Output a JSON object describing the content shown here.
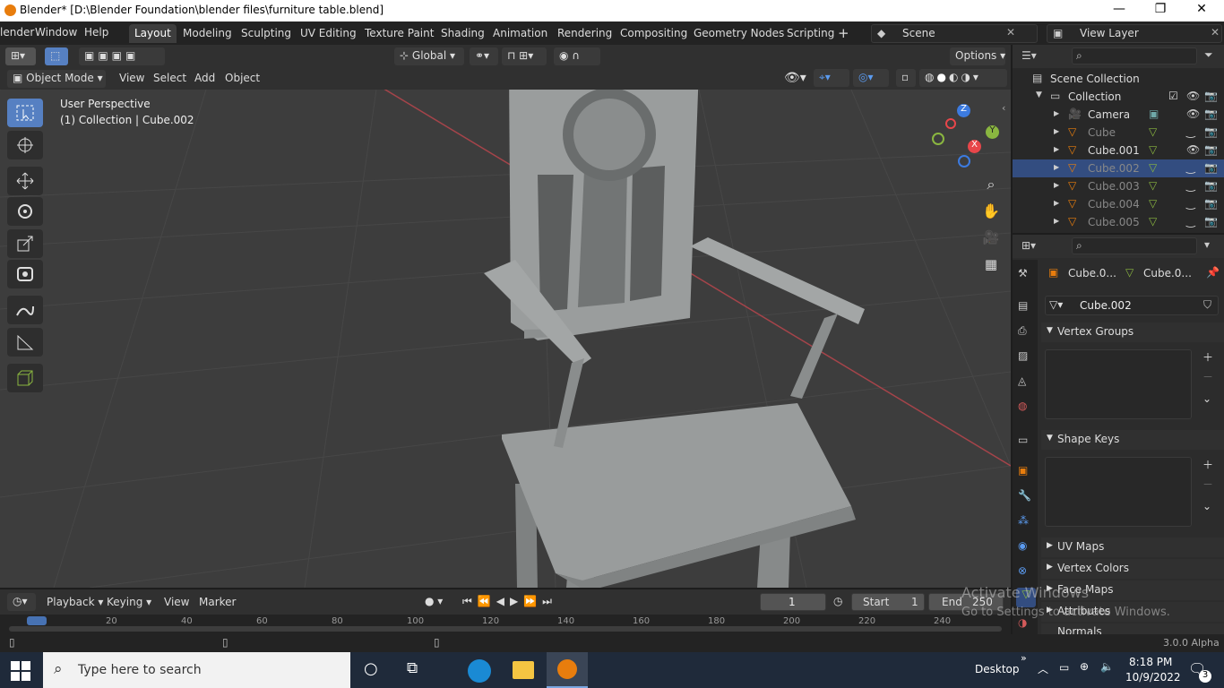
{
  "window": {
    "title": "Blender* [D:\\Blender Foundation\\blender files\\furniture table.blend]",
    "minimize": "—",
    "maximize": "❐",
    "close": "✕"
  },
  "workspaces": [
    "Layout",
    "Modeling",
    "Sculpting",
    "UV Editing",
    "Texture Paint",
    "Shading",
    "Animation",
    "Rendering",
    "Compositing",
    "Geometry Nodes",
    "Scripting"
  ],
  "menus": {
    "blender": "lender",
    "window": "Window",
    "help": "Help"
  },
  "scene": {
    "name": "Scene",
    "view_layer": "View Layer"
  },
  "viewport_header": {
    "transform_orientation": "Global",
    "options": "Options",
    "mode": "Object Mode",
    "menu_view": "View",
    "menu_select": "Select",
    "menu_add": "Add",
    "menu_object": "Object"
  },
  "viewport_info": {
    "perspective": "User Perspective",
    "collection": "(1) Collection | Cube.002"
  },
  "gizmo": {
    "z": "Z",
    "y": "Y",
    "x": "X"
  },
  "outliner": {
    "root": "Scene Collection",
    "collection": "Collection",
    "items": [
      {
        "name": "Camera",
        "dim": false
      },
      {
        "name": "Cube",
        "dim": true
      },
      {
        "name": "Cube.001",
        "dim": false
      },
      {
        "name": "Cube.002",
        "dim": true,
        "selected": true
      },
      {
        "name": "Cube.003",
        "dim": true
      },
      {
        "name": "Cube.004",
        "dim": true
      },
      {
        "name": "Cube.005",
        "dim": true
      }
    ]
  },
  "properties": {
    "breadcrumb_object": "Cube.0...",
    "breadcrumb_mesh": "Cube.0...",
    "mesh_name": "Cube.002",
    "panels": {
      "vertex_groups": "Vertex Groups",
      "shape_keys": "Shape Keys",
      "uv_maps": "UV Maps",
      "vertex_colors": "Vertex Colors",
      "face_maps": "Face Maps",
      "attributes": "Attributes",
      "normals": "Normals"
    }
  },
  "timeline": {
    "playback": "Playback",
    "keying": "Keying",
    "view": "View",
    "marker": "Marker",
    "current_frame": "1",
    "start_label": "Start",
    "start": "1",
    "end_label": "End",
    "end": "250",
    "ticks": [
      "0",
      "20",
      "40",
      "60",
      "80",
      "100",
      "120",
      "140",
      "160",
      "180",
      "200",
      "220",
      "240"
    ]
  },
  "status": {
    "version": "3.0.0 Alpha"
  },
  "watermark": {
    "line1": "Activate Windows",
    "line2": "Go to Settings to activate Windows."
  },
  "taskbar": {
    "search_placeholder": "Type here to search",
    "desktop": "Desktop",
    "time": "8:18 PM",
    "date": "10/9/2022",
    "notifications": "3"
  },
  "colors": {
    "accent": "#5680c2",
    "selected_row": "#334d80",
    "orange": "#e87d0d",
    "x_axis": "#e8464a",
    "y_axis": "#8ab640",
    "z_axis": "#3c7be0"
  }
}
